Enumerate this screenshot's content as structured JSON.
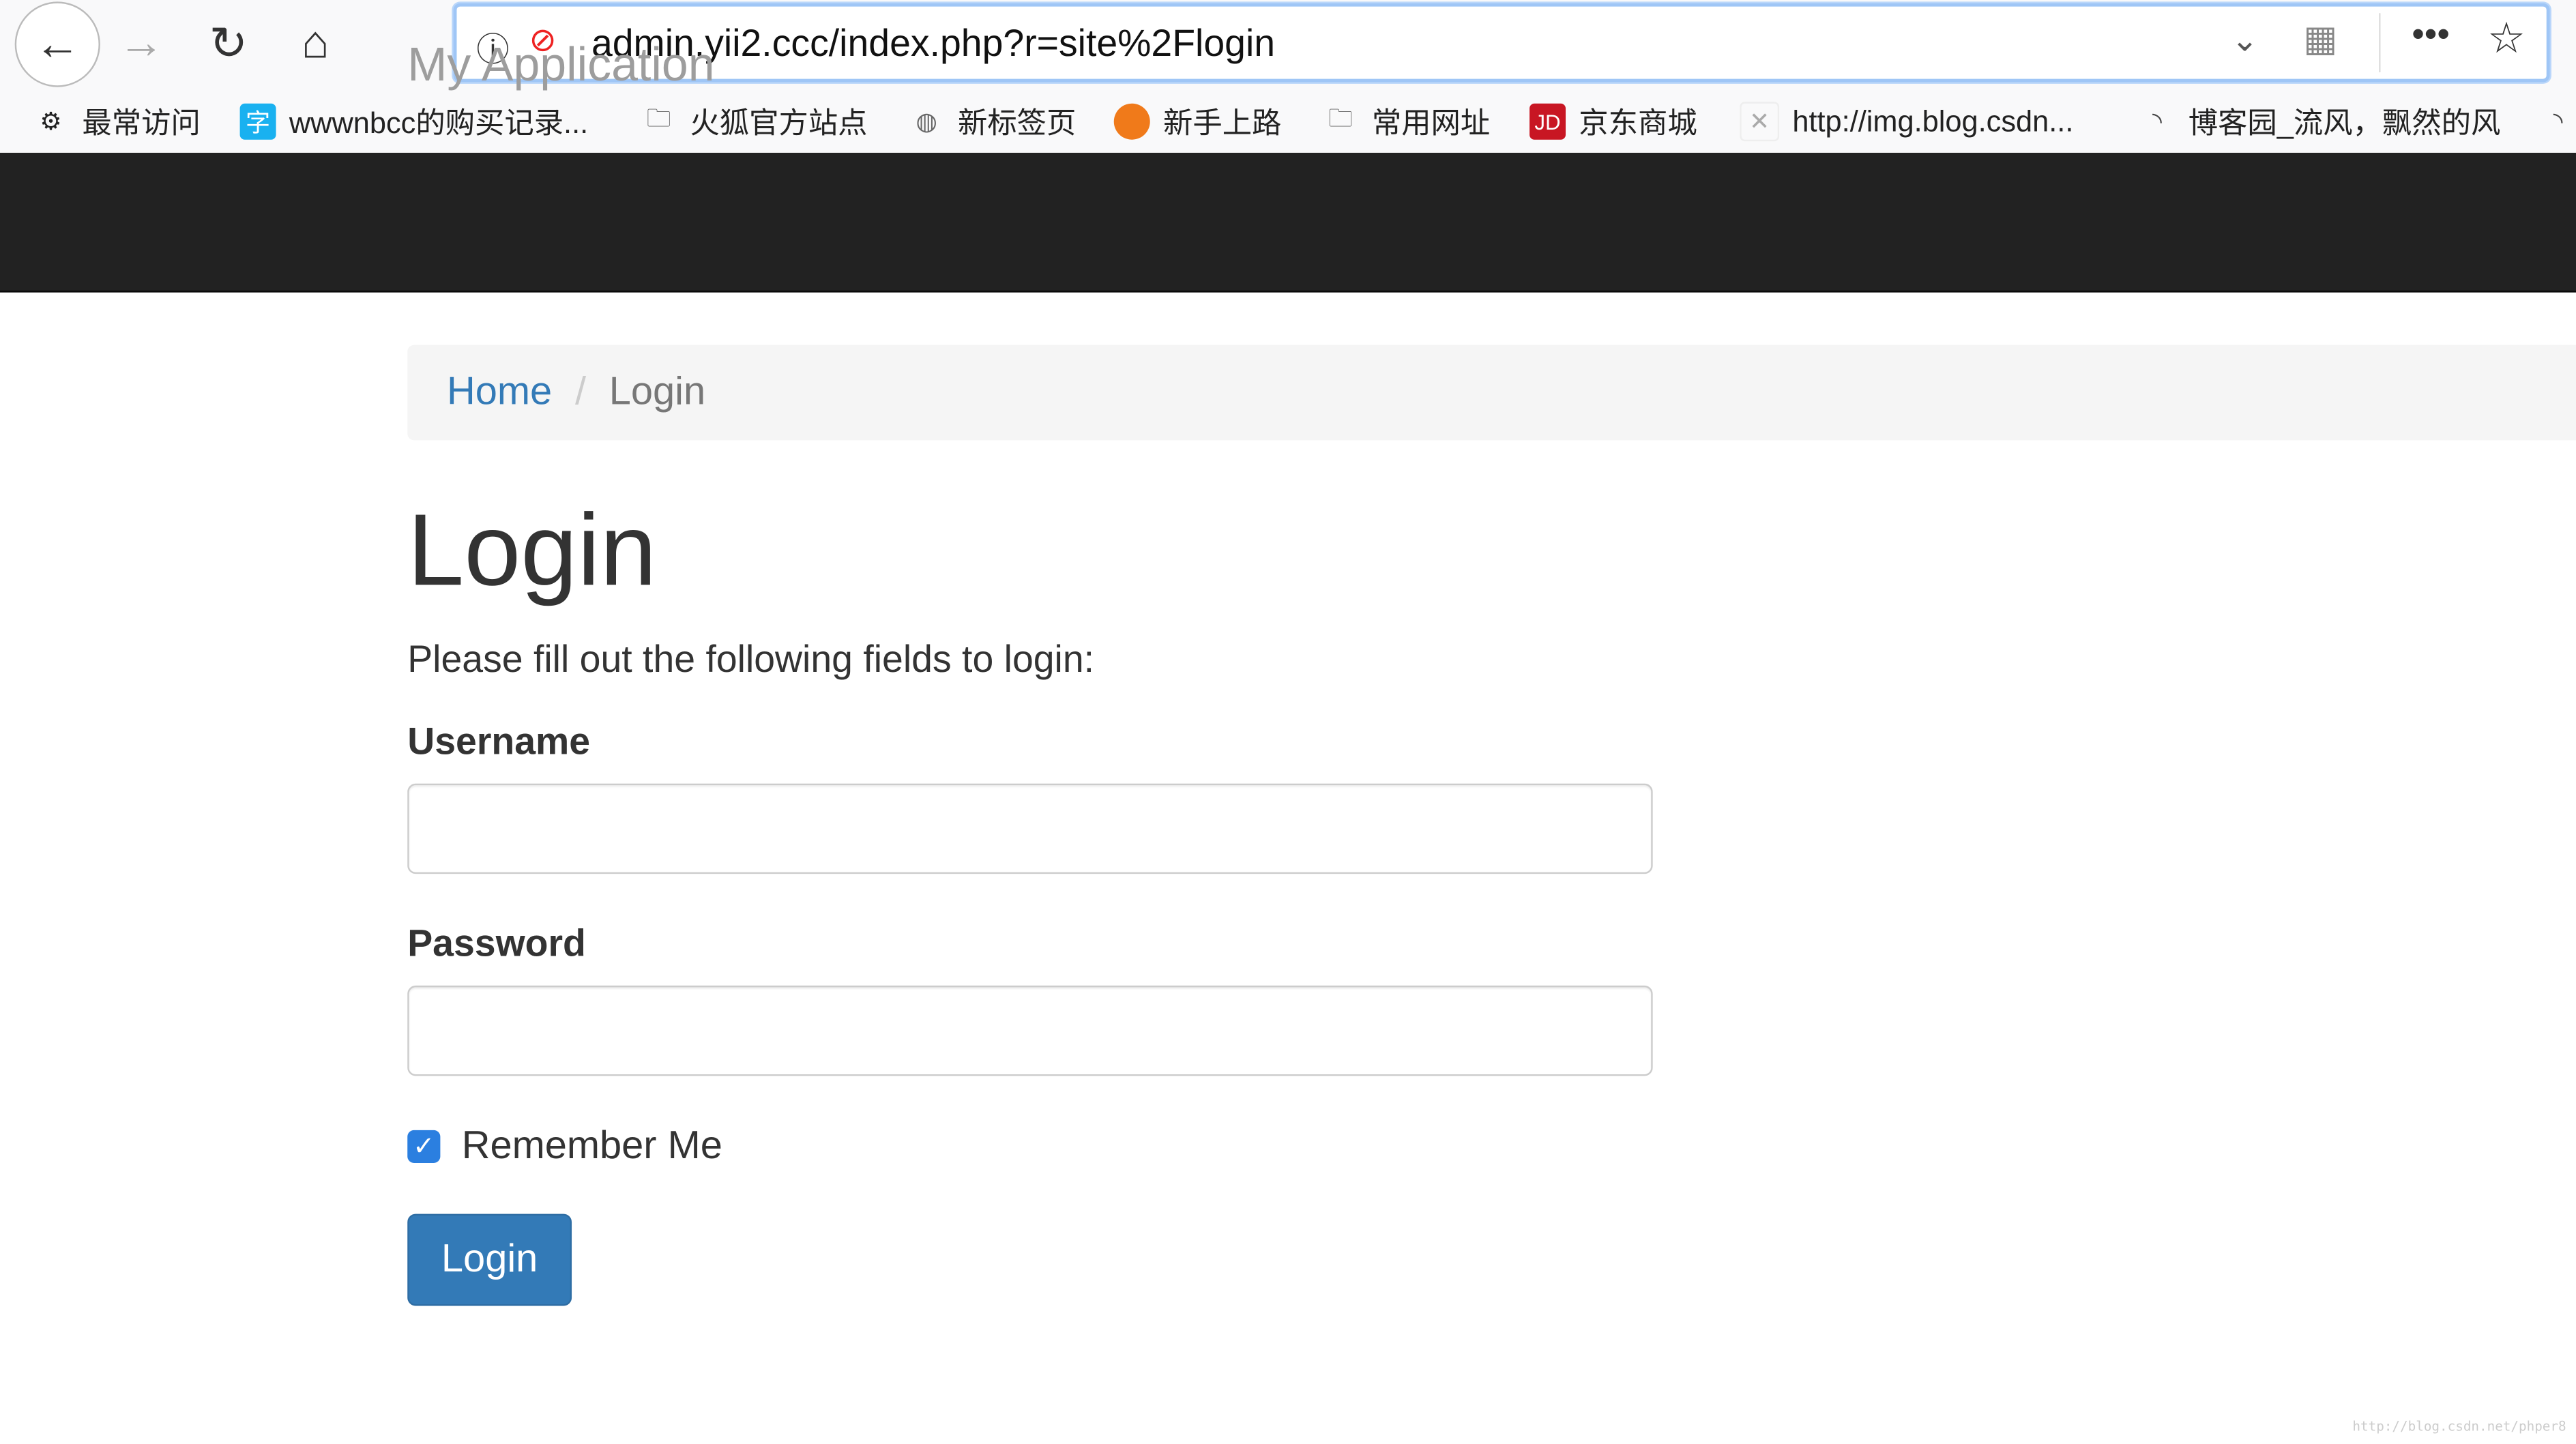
{
  "browser": {
    "url": "admin.yii2.ccc/index.php?r=site%2Flogin",
    "bookmarks": [
      {
        "label": "最常访问",
        "icon": "gear-icon"
      },
      {
        "label": "wwwnbcc的购买记录...",
        "icon": "app-icon"
      },
      {
        "label": "火狐官方站点",
        "icon": "folder-icon"
      },
      {
        "label": "新标签页",
        "icon": "globe-icon"
      },
      {
        "label": "新手上路",
        "icon": "firefox-icon"
      },
      {
        "label": "常用网址",
        "icon": "folder-icon"
      },
      {
        "label": "京东商城",
        "icon": "jd-icon"
      },
      {
        "label": "http://img.blog.csdn...",
        "icon": "broken-image-icon"
      },
      {
        "label": "博客园_流风，飘然的风",
        "icon": "rss-icon"
      }
    ]
  },
  "navbar": {
    "brand": "My Application"
  },
  "breadcrumb": {
    "home": "Home",
    "separator": "/",
    "current": "Login"
  },
  "page": {
    "title": "Login",
    "lead": "Please fill out the following fields to login:",
    "username_label": "Username",
    "username_value": "",
    "password_label": "Password",
    "password_value": "",
    "remember_label": "Remember Me",
    "remember_checked": true,
    "submit_label": "Login"
  },
  "watermark": "http://blog.csdn.net/phper8",
  "colors": {
    "accent": "#337ab7",
    "navbar": "#222222"
  }
}
